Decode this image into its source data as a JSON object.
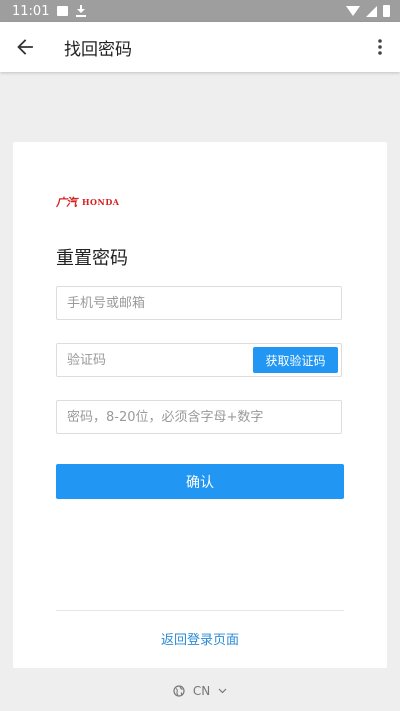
{
  "status_bar": {
    "time": "11:01",
    "icons": [
      "image-icon",
      "download-icon",
      "wifi-icon",
      "signal-icon",
      "battery-icon"
    ]
  },
  "app_bar": {
    "title": "找回密码",
    "back_icon": "arrow-left-icon",
    "menu_icon": "more-vert-icon"
  },
  "card": {
    "logo_mark": "广汽",
    "logo_text": "HONDA",
    "title": "重置密码",
    "phone_placeholder": "手机号或邮箱",
    "code_placeholder": "验证码",
    "get_code_label": "获取验证码",
    "password_placeholder": "密码，8-20位，必须含字母+数字",
    "confirm_label": "确认",
    "return_link": "返回登录页面"
  },
  "region": {
    "label": "CN",
    "icon": "globe-icon"
  },
  "colors": {
    "accent": "#2196f3",
    "brand": "#d32222",
    "link": "#2a8bd6"
  }
}
